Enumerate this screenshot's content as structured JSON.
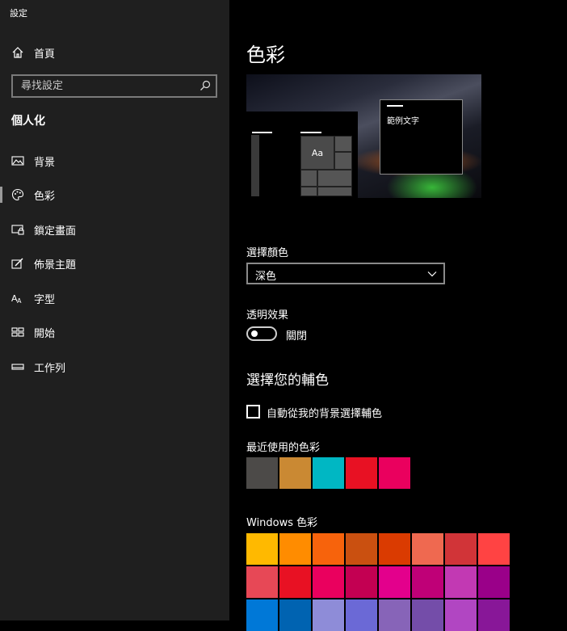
{
  "window": {
    "title": "設定"
  },
  "sidebar": {
    "home_label": "首頁",
    "search_placeholder": "尋找設定",
    "section_title": "個人化",
    "items": [
      {
        "label": "背景",
        "icon": "image-icon",
        "selected": false
      },
      {
        "label": "色彩",
        "icon": "palette-icon",
        "selected": true
      },
      {
        "label": "鎖定畫面",
        "icon": "lock-screen-icon",
        "selected": false
      },
      {
        "label": "佈景主題",
        "icon": "theme-brush-icon",
        "selected": false
      },
      {
        "label": "字型",
        "icon": "font-icon",
        "selected": false
      },
      {
        "label": "開始",
        "icon": "start-icon",
        "selected": false
      },
      {
        "label": "工作列",
        "icon": "taskbar-icon",
        "selected": false
      }
    ]
  },
  "main": {
    "title": "色彩",
    "preview": {
      "tile_text": "Aa",
      "window_text": "範例文字"
    },
    "choose_color": {
      "label": "選擇顏色",
      "value": "深色"
    },
    "transparency": {
      "label": "透明效果",
      "state_text": "關閉",
      "on": false
    },
    "accent_heading": "選擇您的輔色",
    "auto_accent": {
      "label": "自動從我的背景選擇輔色",
      "checked": false
    },
    "recent_colors": {
      "label": "最近使用的色彩",
      "colors": [
        "#4c4a48",
        "#ca8933",
        "#00b7c3",
        "#e81123",
        "#ea005e"
      ]
    },
    "windows_colors": {
      "label": "Windows 色彩",
      "rows": [
        [
          "#ffb900",
          "#ff8c00",
          "#f7630c",
          "#ca5010",
          "#da3b01",
          "#ef6950",
          "#d13438",
          "#ff4343"
        ],
        [
          "#e74856",
          "#e81123",
          "#ea005e",
          "#c30052",
          "#e3008c",
          "#bf0077",
          "#c239b3",
          "#9a0089"
        ],
        [
          "#0078d7",
          "#0063b1",
          "#8e8cd8",
          "#6b69d6",
          "#8764b8",
          "#744da9",
          "#b146c2",
          "#881798"
        ]
      ]
    }
  }
}
